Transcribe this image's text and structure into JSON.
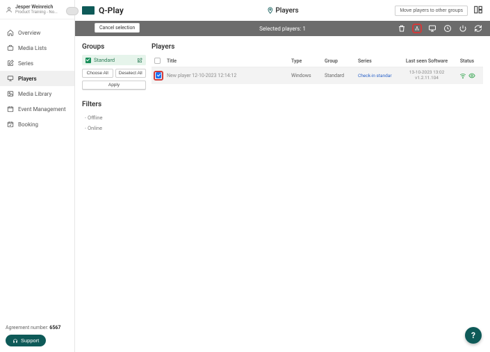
{
  "user": {
    "name": "Jesper Weinreich",
    "subtitle": "Product Training - No..."
  },
  "nav": {
    "items": [
      {
        "id": "overview",
        "label": "Overview"
      },
      {
        "id": "media-lists",
        "label": "Media Lists"
      },
      {
        "id": "series",
        "label": "Series"
      },
      {
        "id": "players",
        "label": "Players"
      },
      {
        "id": "media-library",
        "label": "Media Library"
      },
      {
        "id": "event-management",
        "label": "Event Management"
      },
      {
        "id": "booking",
        "label": "Booking"
      }
    ],
    "activeId": "players"
  },
  "footer": {
    "agreement_label": "Agreement number:",
    "agreement_number": "6567",
    "support": "Support"
  },
  "brand": {
    "name": "Q-Play"
  },
  "page": {
    "title": "Players"
  },
  "header_actions": {
    "move_players": "Move players to other groups"
  },
  "toolbar": {
    "cancel": "Cancel selection",
    "selected_text": "Selected players: 1"
  },
  "groups": {
    "title": "Groups",
    "items": [
      {
        "label": "Standard",
        "checked": true
      }
    ],
    "choose_all": "Choose All",
    "deselect_all": "Deselect All",
    "apply": "Apply"
  },
  "filters": {
    "title": "Filters",
    "items": [
      "Offline",
      "Online"
    ]
  },
  "players": {
    "title": "Players",
    "columns": {
      "title": "Title",
      "type": "Type",
      "group": "Group",
      "series": "Series",
      "last_seen": "Last seen Software",
      "status": "Status"
    },
    "rows": [
      {
        "checked": true,
        "title": "New player 12-10-2023 12:14:12",
        "type": "Windows",
        "group": "Standard",
        "series_label": "Check-in standar",
        "last_seen_line1": "13-10-2023 13:02",
        "last_seen_line2": "v1.2.11.104"
      }
    ]
  },
  "fab": {
    "label": "?"
  }
}
